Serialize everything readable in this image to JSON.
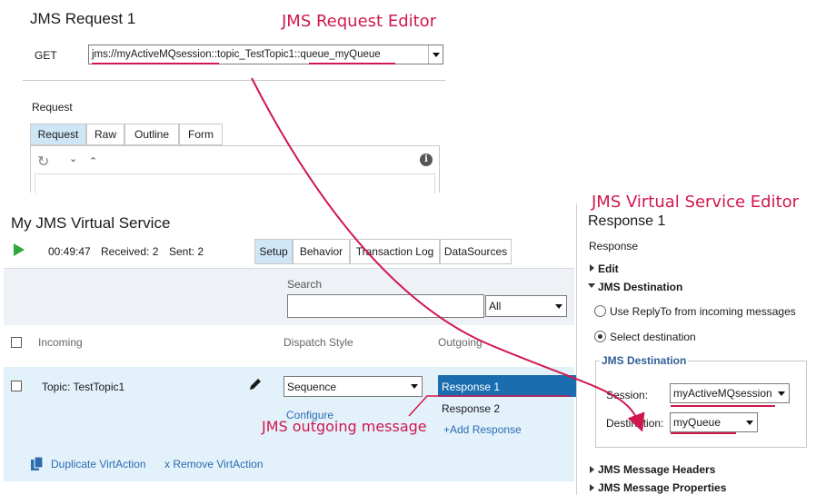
{
  "annotations": {
    "request_editor": "JMS Request Editor",
    "virtual_service_editor": "JMS Virtual Service Editor",
    "outgoing_message": "JMS outgoing message"
  },
  "request_editor": {
    "title": "JMS Request 1",
    "method": "GET",
    "endpoint": "jms://myActiveMQsession::topic_TestTopic1::queue_myQueue",
    "section_label": "Request",
    "tabs": [
      "Request",
      "Raw",
      "Outline",
      "Form"
    ],
    "active_tab": "Request"
  },
  "virtual_service": {
    "title": "My JMS Virtual Service",
    "timer": "00:49:47",
    "received": "Received: 2",
    "sent": "Sent: 2",
    "tabs": [
      "Setup",
      "Behavior",
      "Transaction Log",
      "DataSources"
    ],
    "active_tab": "Setup",
    "search_label": "Search",
    "search_value": "",
    "filter_value": "All",
    "columns": {
      "incoming": "Incoming",
      "dispatch": "Dispatch Style",
      "outgoing": "Outgoing"
    },
    "row": {
      "incoming": "Topic: TestTopic1",
      "dispatch": "Sequence",
      "configure": "Configure",
      "responses": [
        "Response 1",
        "Response 2"
      ],
      "add_response": "+Add Response"
    },
    "duplicate": "Duplicate VirtAction",
    "remove": "x Remove VirtAction"
  },
  "response_panel": {
    "title": "Response 1",
    "subtitle": "Response",
    "edit": "Edit",
    "jms_destination": "JMS Destination",
    "option_replyto": "Use ReplyTo from incoming messages",
    "option_select": "Select destination",
    "group_title": "JMS Destination",
    "session_label": "Session:",
    "session_value": "myActiveMQsession",
    "destination_label": "Destination:",
    "destination_value": "myQueue",
    "headers": "JMS Message Headers",
    "properties": "JMS Message Properties"
  },
  "colors": {
    "accent_red": "#d0184e",
    "selected_blue": "#1a6eb0",
    "row_blue": "#e3f1fb",
    "tab_active": "#cfe6f7"
  }
}
